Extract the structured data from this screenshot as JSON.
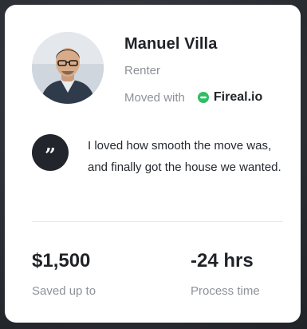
{
  "testimonial": {
    "name": "Manuel Villa",
    "role": "Renter",
    "moved_with_label": "Moved with",
    "brand_name": "Fireal.io",
    "brand_icon": "fireal-logo-icon",
    "quote_icon": "quote-icon",
    "quote": "I loved how smooth the move was, and finally got the house we wanted."
  },
  "stats": [
    {
      "value": "$1,500",
      "label": "Saved up to"
    },
    {
      "value": "-24 hrs",
      "label": "Process time"
    }
  ],
  "colors": {
    "brand": "#2fbe64",
    "text_dark": "#1f2328",
    "text_muted": "#8d9197",
    "badge_bg": "#22262c"
  }
}
